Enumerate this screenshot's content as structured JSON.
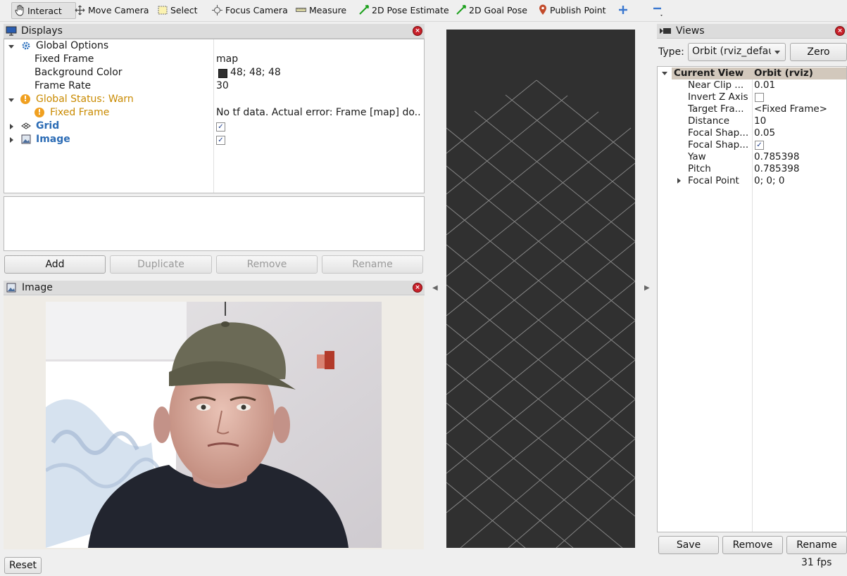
{
  "toolbar": {
    "interact": "Interact",
    "move_camera": "Move Camera",
    "select": "Select",
    "focus_camera": "Focus Camera",
    "measure": "Measure",
    "pose_estimate": "2D Pose Estimate",
    "goal_pose": "2D Goal Pose",
    "publish_point": "Publish Point"
  },
  "displays": {
    "title": "Displays",
    "global_options": "Global Options",
    "fixed_frame_label": "Fixed Frame",
    "fixed_frame_value": "map",
    "bg_color_label": "Background Color",
    "bg_color_value": "48; 48; 48",
    "bg_color_swatch": "#303030",
    "frame_rate_label": "Frame Rate",
    "frame_rate_value": "30",
    "global_status": "Global Status: Warn",
    "status_fixed_frame": "Fixed Frame",
    "status_error": "No tf data.  Actual error: Frame [map] do...",
    "grid": "Grid",
    "image": "Image",
    "buttons": {
      "add": "Add",
      "duplicate": "Duplicate",
      "remove": "Remove",
      "rename": "Rename"
    }
  },
  "image_panel": {
    "title": "Image"
  },
  "views": {
    "title": "Views",
    "type_label": "Type:",
    "type_value": "Orbit (rviz_defau",
    "zero": "Zero",
    "header_name": "Current View",
    "header_value": "Orbit (rviz)",
    "rows": [
      {
        "label": "Near Clip ...",
        "value": "0.01"
      },
      {
        "label": "Invert Z Axis",
        "value": ""
      },
      {
        "label": "Target Fra...",
        "value": "<Fixed Frame>"
      },
      {
        "label": "Distance",
        "value": "10"
      },
      {
        "label": "Focal Shap...",
        "value": "0.05"
      },
      {
        "label": "Focal Shap...",
        "value": ""
      },
      {
        "label": "Yaw",
        "value": "0.785398"
      },
      {
        "label": "Pitch",
        "value": "0.785398"
      },
      {
        "label": "Focal Point",
        "value": "0; 0; 0"
      }
    ],
    "buttons": {
      "save": "Save",
      "remove": "Remove",
      "rename": "Rename"
    }
  },
  "status_bar": {
    "reset": "Reset",
    "fps": "31 fps"
  }
}
